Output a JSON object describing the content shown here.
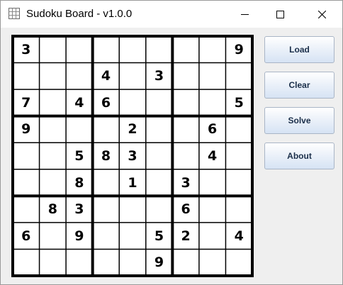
{
  "window": {
    "title": "Sudoku Board - v1.0.0"
  },
  "icons": {
    "app": "grid-icon",
    "minimize": "minimize-icon",
    "maximize": "maximize-icon",
    "close": "close-icon"
  },
  "buttons": {
    "load": "Load",
    "clear": "Clear",
    "solve": "Solve",
    "about": "About"
  },
  "board": {
    "rows": [
      [
        "3",
        "",
        "",
        "",
        "",
        "",
        "",
        "",
        "9"
      ],
      [
        "",
        "",
        "",
        "4",
        "",
        "3",
        "",
        "",
        ""
      ],
      [
        "7",
        "",
        "4",
        "6",
        "",
        "",
        "",
        "",
        "5"
      ],
      [
        "9",
        "",
        "",
        "",
        "2",
        "",
        "",
        "6",
        ""
      ],
      [
        "",
        "",
        "5",
        "8",
        "3",
        "",
        "",
        "4",
        ""
      ],
      [
        "",
        "",
        "8",
        "",
        "1",
        "",
        "3",
        "",
        ""
      ],
      [
        "",
        "8",
        "3",
        "",
        "",
        "",
        "6",
        "",
        ""
      ],
      [
        "6",
        "",
        "9",
        "",
        "",
        "5",
        "2",
        "",
        "4"
      ],
      [
        "",
        "",
        "",
        "",
        "",
        "9",
        "",
        "",
        ""
      ]
    ]
  }
}
